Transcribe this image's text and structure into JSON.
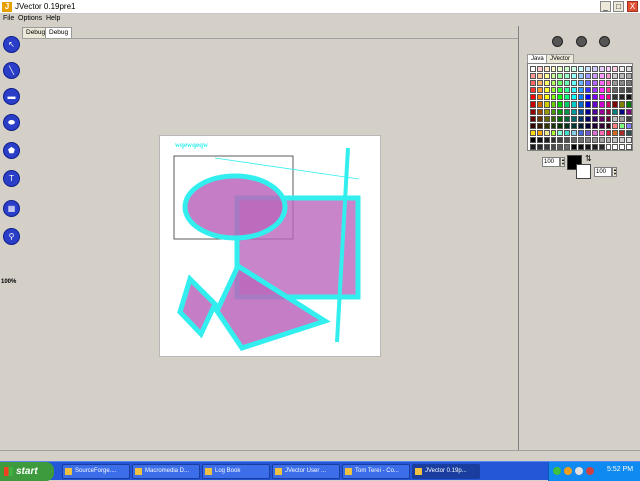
{
  "window": {
    "title": "JVector 0.19pre1",
    "app_icon": "J",
    "min_label": "_",
    "max_label": "□",
    "close_label": "X"
  },
  "menu": [
    "File",
    "Options",
    "Help"
  ],
  "doc_tabs": [
    "Debug",
    "Debug"
  ],
  "tools": [
    {
      "icon": "select-arrow-icon",
      "glyph": "↖"
    },
    {
      "icon": "line-icon",
      "glyph": "╲"
    },
    {
      "icon": "rectangle-icon",
      "glyph": "▬"
    },
    {
      "icon": "ellipse-icon",
      "glyph": "⬬"
    },
    {
      "icon": "polygon-icon",
      "glyph": "⬟"
    },
    {
      "icon": "text-icon",
      "glyph": "T"
    },
    {
      "icon": "grid-icon",
      "glyph": "▦"
    },
    {
      "icon": "zoom-icon",
      "glyph": "⚲"
    }
  ],
  "zoom_level": "100%",
  "canvas_text": "wqewqeqw",
  "palette_tabs": [
    "Java",
    "JVector"
  ],
  "palette_colors": [
    "#ffffff",
    "#ffcccc",
    "#ffe6cc",
    "#ffffcc",
    "#e6ffcc",
    "#ccffcc",
    "#ccffe6",
    "#ccffff",
    "#cce6ff",
    "#ccccff",
    "#e6ccff",
    "#ffccff",
    "#ffcce6",
    "#eeeeee",
    "#dddddd",
    "#ff9999",
    "#ffcc99",
    "#ffff99",
    "#ccff99",
    "#99ff99",
    "#99ffcc",
    "#99ffff",
    "#99ccff",
    "#9999ff",
    "#cc99ff",
    "#ff99ff",
    "#ff99cc",
    "#cccccc",
    "#bbbbbb",
    "#aaaaaa",
    "#ff6666",
    "#ffb366",
    "#ffff66",
    "#b3ff66",
    "#66ff66",
    "#66ffb3",
    "#66ffff",
    "#66b3ff",
    "#6666ff",
    "#b366ff",
    "#ff66ff",
    "#ff66b3",
    "#999999",
    "#888888",
    "#777777",
    "#ff3333",
    "#ff9933",
    "#ffff33",
    "#99ff33",
    "#33ff33",
    "#33ff99",
    "#33ffff",
    "#3399ff",
    "#3333ff",
    "#9933ff",
    "#ff33ff",
    "#ff3399",
    "#666666",
    "#555555",
    "#444444",
    "#ff0000",
    "#ff8000",
    "#ffff00",
    "#80ff00",
    "#00ff00",
    "#00ff80",
    "#00ffff",
    "#0080ff",
    "#0000ff",
    "#8000ff",
    "#ff00ff",
    "#ff0080",
    "#333333",
    "#222222",
    "#111111",
    "#cc0000",
    "#cc6600",
    "#cccc00",
    "#66cc00",
    "#00cc00",
    "#00cc66",
    "#00cccc",
    "#0066cc",
    "#0000cc",
    "#6600cc",
    "#cc00cc",
    "#cc0066",
    "#800000",
    "#808000",
    "#008000",
    "#990000",
    "#994c00",
    "#999900",
    "#4c9900",
    "#009900",
    "#00994c",
    "#009999",
    "#004c99",
    "#000099",
    "#4c0099",
    "#990099",
    "#99004c",
    "#008080",
    "#000080",
    "#800080",
    "#660000",
    "#663300",
    "#666600",
    "#336600",
    "#006600",
    "#006633",
    "#006666",
    "#003366",
    "#000066",
    "#330066",
    "#660066",
    "#660033",
    "#c0c0c0",
    "#a0a0a0",
    "#404040",
    "#330000",
    "#331a00",
    "#333300",
    "#1a3300",
    "#003300",
    "#00331a",
    "#003333",
    "#001a33",
    "#000033",
    "#1a0033",
    "#330033",
    "#33001a",
    "#ff8080",
    "#80ff80",
    "#8080ff",
    "#ffd700",
    "#ffa500",
    "#f0e68c",
    "#adff2f",
    "#7fffd4",
    "#40e0d0",
    "#87ceeb",
    "#4169e1",
    "#6a5acd",
    "#da70d6",
    "#ff69b4",
    "#dc143c",
    "#d2691e",
    "#a52a2a",
    "#2f4f4f",
    "#000000",
    "#101010",
    "#202020",
    "#303030",
    "#404040",
    "#505050",
    "#606060",
    "#707070",
    "#808080",
    "#909090",
    "#a0a0a0",
    "#b0b0b0",
    "#c0c0c0",
    "#d0d0d0",
    "#e0e0e0",
    "#1a1a1a",
    "#2a2a2a",
    "#3a3a3a",
    "#4a4a4a",
    "#5a5a5a",
    "#6a6a6a",
    "#000000",
    "#0a0a0a",
    "#141414",
    "#1e1e1e",
    "#282828",
    "#ffffff",
    "#ffffff",
    "#ffffff",
    "#ffffff"
  ],
  "fg_alpha": "100",
  "bg_alpha": "100",
  "panel_icons": [
    "save-icon",
    "layers-icon",
    "help-icon"
  ],
  "taskbar": {
    "start": "start",
    "tasks": [
      {
        "label": "SourceForge....",
        "active": false
      },
      {
        "label": "Macromedia D...",
        "active": false
      },
      {
        "label": "Log Book",
        "active": false
      },
      {
        "label": "JVector User ...",
        "active": false
      },
      {
        "label": "Tom Terei - Co...",
        "active": false
      },
      {
        "label": "JVector 0.19p...",
        "active": true
      }
    ],
    "clock": "5:52 PM"
  },
  "colors": {
    "cyan_stroke": "#33eeee",
    "purple_fill": "#bb66bb",
    "taskbar_blue": "#2456d8"
  }
}
